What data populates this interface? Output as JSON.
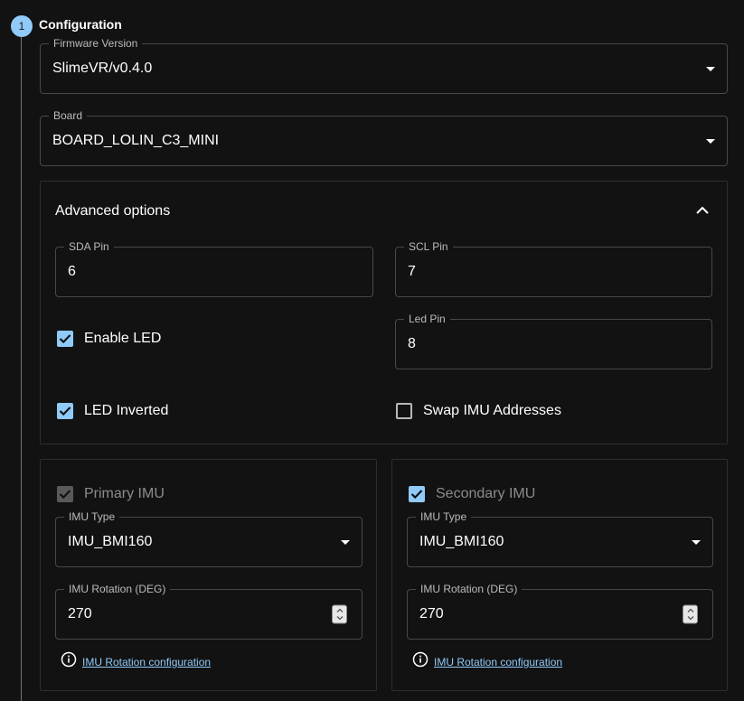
{
  "step": {
    "number": "1",
    "title": "Configuration"
  },
  "firmware": {
    "label": "Firmware Version",
    "value": "SlimeVR/v0.4.0"
  },
  "board": {
    "label": "Board",
    "value": "BOARD_LOLIN_C3_MINI"
  },
  "advanced": {
    "title": "Advanced options",
    "sda": {
      "label": "SDA Pin",
      "value": "6"
    },
    "scl": {
      "label": "SCL Pin",
      "value": "7"
    },
    "enable_led": {
      "label": "Enable LED",
      "checked": true
    },
    "led_pin": {
      "label": "Led Pin",
      "value": "8"
    },
    "led_inverted": {
      "label": "LED Inverted",
      "checked": true
    },
    "swap_imu": {
      "label": "Swap IMU Addresses",
      "checked": false
    }
  },
  "primary_imu": {
    "label": "Primary IMU",
    "checked": true,
    "disabled": true,
    "type_label": "IMU Type",
    "type_value": "IMU_BMI160",
    "rotation_label": "IMU Rotation (DEG)",
    "rotation_value": "270",
    "link": "IMU Rotation configuration"
  },
  "secondary_imu": {
    "label": "Secondary IMU",
    "checked": true,
    "type_label": "IMU Type",
    "type_value": "IMU_BMI160",
    "rotation_label": "IMU Rotation (DEG)",
    "rotation_value": "270",
    "link": "IMU Rotation configuration"
  },
  "colors": {
    "accent": "#90caf9",
    "background": "#121212"
  }
}
